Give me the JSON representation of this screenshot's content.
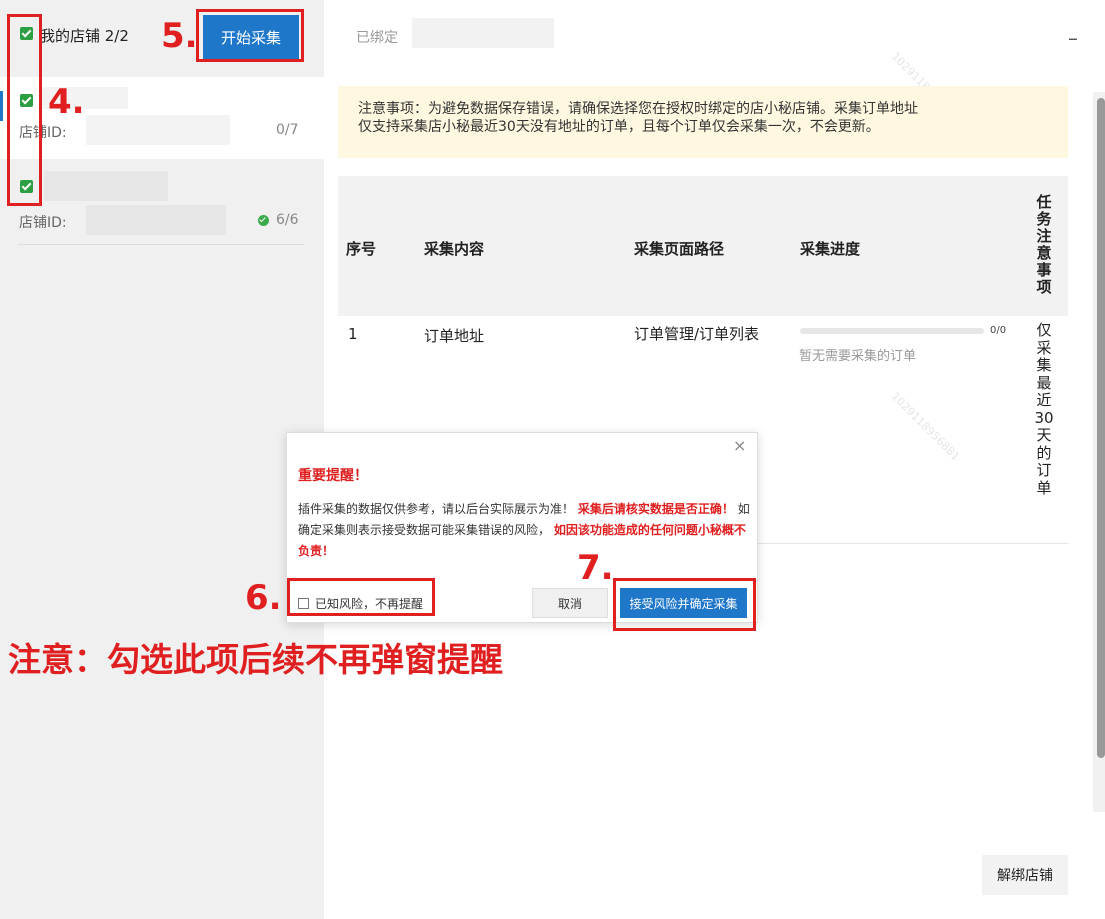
{
  "sidebar": {
    "my_shops_label": "我的店铺 2/2",
    "start_button": "开始采集",
    "shops": [
      {
        "id_label": "店铺ID:",
        "count": "0/7"
      },
      {
        "id_label": "店铺ID:",
        "count": "6/6"
      }
    ]
  },
  "steps": {
    "s4": "4.",
    "s5": "5.",
    "s6": "6.",
    "s7": "7."
  },
  "main": {
    "bound_label": "已绑定",
    "minimize": "–",
    "notice_line1": "注意事项：为避免数据保存错误，请确保选择您在授权时绑定的店小秘店铺。采集订单地址",
    "notice_line2": "仅支持采集店小秘最近30天没有地址的订单，且每个订单仅会采集一次，不会更新。",
    "table": {
      "headers": [
        "序号",
        "采集内容",
        "采集页面路径",
        "采集进度",
        "任务注意事项"
      ],
      "rows": [
        {
          "index": "1",
          "content": "订单地址",
          "path": "订单管理/订单列表",
          "progress_text": "0/0",
          "progress_fraction": 0,
          "empty_note": "暂无需要采集的订单",
          "task_note": "仅采集最近30天的订单"
        }
      ]
    },
    "unbind_button": "解绑店铺"
  },
  "modal": {
    "close": "×",
    "title": "重要提醒！",
    "body_1": "插件采集的数据仅供参考，请以后台实际展示为准！",
    "body_2_red": "采集后请核实数据是否正确！",
    "body_3": "如确定采集则表示接受数据可能采集错误的风险，",
    "body_4_red": "如因该功能造成的任何问题小秘概不负责！",
    "checkbox_label": "已知风险，不再提醒",
    "cancel_button": "取消",
    "confirm_button": "接受风险并确定采集"
  },
  "annotation": "注意：勾选此项后续不再弹窗提醒",
  "watermark": "1029118956881",
  "colors": {
    "accent": "#1f77c9",
    "annotation_red": "#e02020",
    "checkbox_green": "#2e9e43",
    "notice_bg": "#fff8e0"
  }
}
